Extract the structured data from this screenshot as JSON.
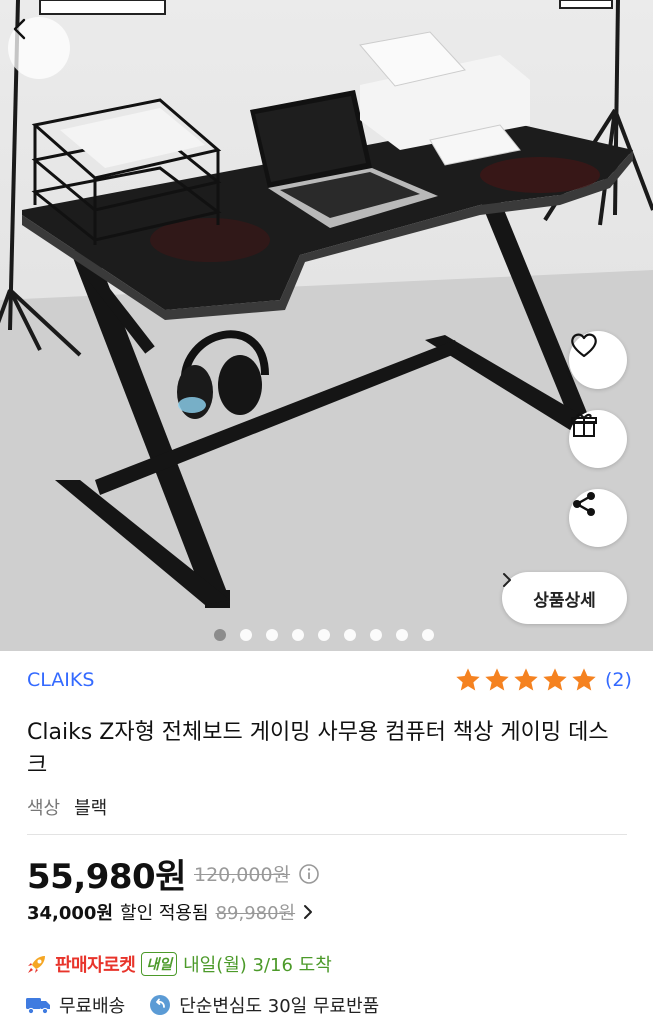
{
  "brand": "CLAIKS",
  "rating": {
    "stars": 5,
    "count": "(2)",
    "color": "#f58220"
  },
  "product": {
    "title": "Claiks Z자형 전체보드 게이밍 사무용 컴퓨터 책상 게이밍 데스크",
    "option_label": "색상",
    "option_value": "블랙"
  },
  "price": {
    "sale": "55,980원",
    "original": "120,000원",
    "coupon_price": "34,000원",
    "coupon_label": "할인 적용됨",
    "coupon_original": "89,980원"
  },
  "delivery": {
    "rocket_label": "판매자로켓",
    "tomorrow_badge": "내일",
    "arrival": "내일(월) 3/16 도착"
  },
  "benefits": {
    "free_shipping": "무료배송",
    "free_return": "단순변심도 30일 무료반품"
  },
  "hero": {
    "detail_button": "상품상세",
    "image_count": 9,
    "active_index": 0
  },
  "colors": {
    "accent": "#346aff",
    "rocket": "#e8342b",
    "delivery_green": "#4c9a2a"
  }
}
